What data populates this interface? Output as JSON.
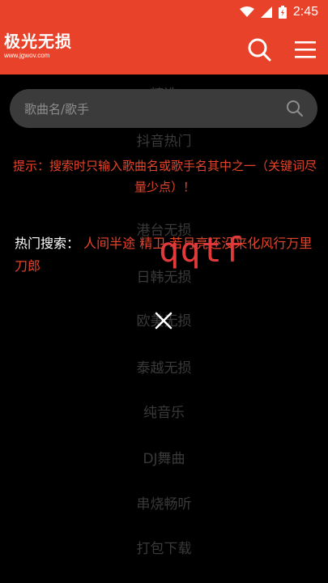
{
  "status": {
    "time": "2:45"
  },
  "app": {
    "logo_title": "极光无损",
    "logo_subtitle": "www.jgwov.com"
  },
  "search": {
    "placeholder": "歌曲名/歌手",
    "value": ""
  },
  "tip": {
    "text": "提示：搜索时只输入歌曲名或歌手名其中之一（关键词尽量少点）！"
  },
  "hot": {
    "label": "热门搜索：",
    "items": [
      "人间半途",
      "精卫",
      "若月亮还没来",
      "化风行万里",
      "刀郎"
    ]
  },
  "categories": [
    "精选",
    "抖音热门",
    "港台无损",
    "日韩无损",
    "欧美无损",
    "泰越无损",
    "纯音乐",
    "DJ舞曲",
    "串烧畅听",
    "打包下载"
  ],
  "overlay": {
    "text": "qqtf"
  },
  "colors": {
    "accent": "#e8432a",
    "background": "#000000",
    "search_bg": "#3b3b3b"
  },
  "icons": [
    "wifi-icon",
    "signal-icon",
    "battery-icon",
    "search-icon",
    "menu-icon",
    "close-icon"
  ]
}
